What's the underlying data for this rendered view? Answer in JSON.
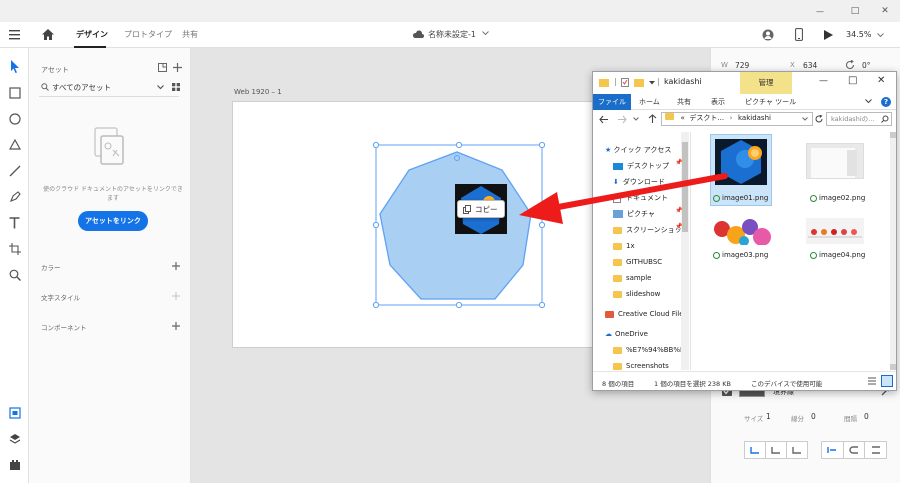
{
  "window": {
    "minimize": "—",
    "maximize": "□",
    "close": "✕"
  },
  "header": {
    "tabs": [
      "デザイン",
      "プロトタイプ",
      "共有"
    ],
    "doc_title": "名称未設定-1",
    "zoom": "34.5%"
  },
  "assets": {
    "title": "アセット",
    "filter": "すべてのアセット",
    "empty_text": "使のクラウド ドキュメントのアセットをリンクできます",
    "link_button": "アセットをリンク",
    "colors": "カラー",
    "text_styles": "文字スタイル",
    "components": "コンポーネント"
  },
  "canvas": {
    "artboard_label": "Web 1920 – 1",
    "tooltip": "コピー"
  },
  "props": {
    "w_label": "W",
    "w_value": "729",
    "x_label": "X",
    "x_value": "634",
    "rot_value": "0°",
    "border_label": "境界線",
    "size_label": "サイズ",
    "size_value": "1",
    "dash_label": "線分",
    "dash_value": "0",
    "gap_label": "間隔",
    "gap_value": "0"
  },
  "explorer": {
    "title": "kakidashi",
    "manage": "管理",
    "ribbon_tabs": [
      "ファイル",
      "ホーム",
      "共有",
      "表示",
      "ピクチャ ツール"
    ],
    "path_prefix": "«",
    "path": [
      "デスクト...",
      "kakidashi"
    ],
    "search_placeholder": "kakidashiの...",
    "nav": {
      "quick_access": "クイック アクセス",
      "desktop": "デスクトップ",
      "downloads": "ダウンロード",
      "documents": "ドキュメント",
      "pictures": "ピクチャ",
      "screenshots_jp": "スクリーンショッ",
      "f1": "1x",
      "f2": "GITHUBSC",
      "f3": "sample",
      "f4": "slideshow",
      "creative_cloud": "Creative Cloud File",
      "onedrive": "OneDrive",
      "od1": "%E7%94%BB%E5",
      "od2": "Screenshots"
    },
    "files": [
      "image01.png",
      "image02.png",
      "image03.png",
      "image04.png"
    ],
    "status_items": "8 個の項目",
    "status_selected": "1 個の項目を選択  238 KB",
    "status_device": "このデバイスで使用可能"
  }
}
